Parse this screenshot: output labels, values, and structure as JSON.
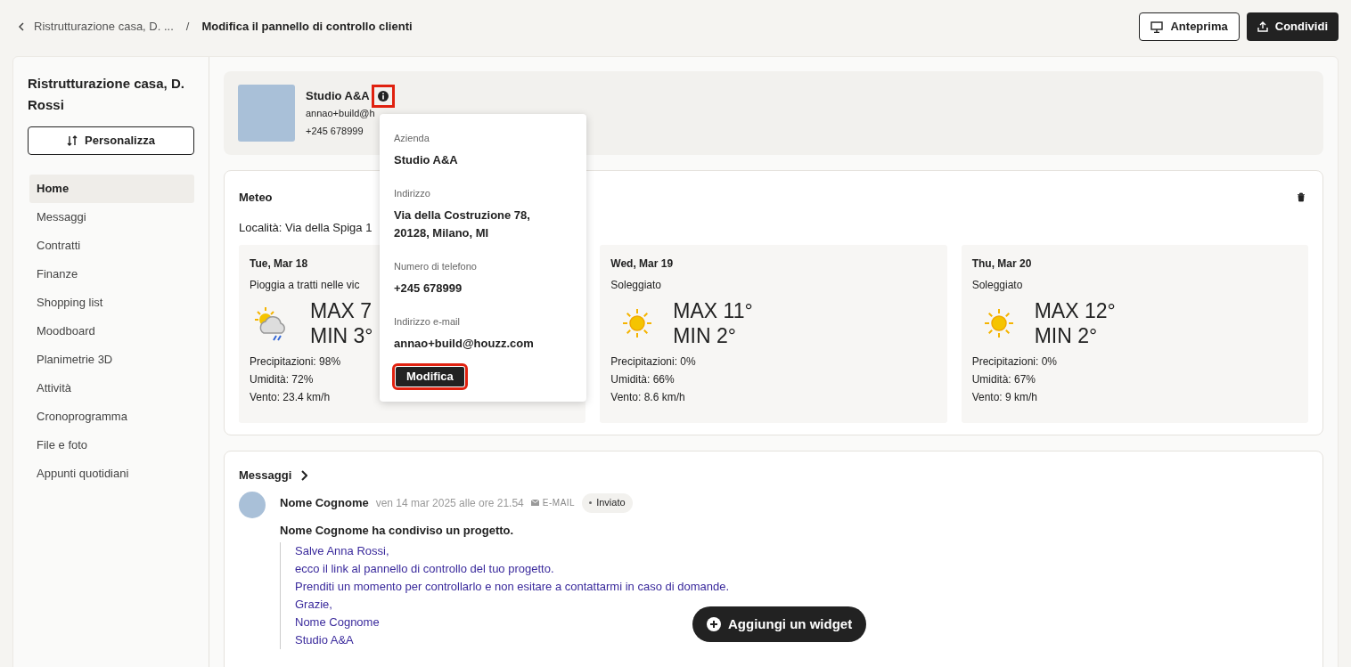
{
  "breadcrumb": {
    "parent": "Ristrutturazione casa, D. ...",
    "separator": "/",
    "current": "Modifica il pannello di controllo clienti"
  },
  "header_buttons": [
    {
      "kind": "preview",
      "label": "Anteprima"
    },
    {
      "kind": "share",
      "label": "Condividi"
    }
  ],
  "sidebar": {
    "title": "Ristrutturazione casa, D. Rossi",
    "customize_button": "Personalizza",
    "items": [
      {
        "label": "Home",
        "selected": true
      },
      {
        "label": "Messaggi",
        "selected": false
      },
      {
        "label": "Contratti",
        "selected": false
      },
      {
        "label": "Finanze",
        "selected": false
      },
      {
        "label": "Shopping list",
        "selected": false
      },
      {
        "label": "Moodboard",
        "selected": false
      },
      {
        "label": "Planimetrie 3D",
        "selected": false
      },
      {
        "label": "Attività",
        "selected": false
      },
      {
        "label": "Cronoprogramma",
        "selected": false
      },
      {
        "label": "File e foto",
        "selected": false
      },
      {
        "label": "Appunti quotidiani",
        "selected": false
      }
    ]
  },
  "company_card": {
    "name": "Studio A&A",
    "info_highlighted": true,
    "email": "annao+build@h",
    "phone": "+245 678999"
  },
  "popover": {
    "fields": [
      {
        "label": "Azienda",
        "value": "Studio A&A"
      },
      {
        "label": "Indirizzo",
        "value": "Via della Costruzione 78, 20128, Milano, MI"
      },
      {
        "label": "Numero di telefono",
        "value": "+245 678999"
      },
      {
        "label": "Indirizzo e-mail",
        "value": "annao+build@houzz.com"
      }
    ],
    "edit_button": "Modifica",
    "edit_highlighted": true
  },
  "weather": {
    "title": "Meteo",
    "location": "Località: Via della Spiga 1",
    "days": [
      {
        "date": "Tue, Mar 18",
        "kind": "rain",
        "description": "Pioggia a tratti nelle vic",
        "max": "MAX 7",
        "min": "MIN 3°",
        "precipitation": "Precipitazioni: 98%",
        "humidity": "Umidità: 72%",
        "wind": "Vento: 23.4 km/h"
      },
      {
        "date": "Wed, Mar 19",
        "kind": "sun",
        "description": "Soleggiato",
        "max": "MAX 11°",
        "min": "MIN 2°",
        "precipitation": "Precipitazioni: 0%",
        "humidity": "Umidità: 66%",
        "wind": "Vento: 8.6 km/h"
      },
      {
        "date": "Thu, Mar 20",
        "kind": "sun",
        "description": "Soleggiato",
        "max": "MAX 12°",
        "min": "MIN 2°",
        "precipitation": "Precipitazioni: 0%",
        "humidity": "Umidità: 67%",
        "wind": "Vento: 9 km/h"
      }
    ]
  },
  "messages": {
    "title": "Messaggi",
    "items": [
      {
        "sender": "Nome Cognome",
        "date": "ven 14 mar 2025 alle ore 21.54",
        "channel": "E-MAIL",
        "status": "Inviato",
        "summary": "Nome Cognome ha condiviso un progetto.",
        "body": [
          "Salve Anna Rossi,",
          "ecco il link al pannello di controllo del tuo progetto.",
          "Prenditi un momento per controllarlo e non esitare a contattarmi in caso di domande.",
          "Grazie,",
          "Nome Cognome",
          "Studio A&A"
        ]
      }
    ]
  },
  "add_widget_button": "Aggiungi un widget"
}
